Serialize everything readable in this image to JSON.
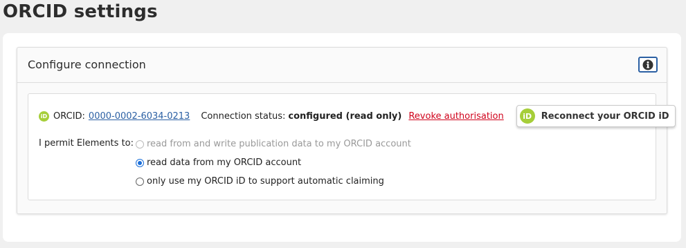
{
  "page": {
    "title": "ORCID settings"
  },
  "panel": {
    "title": "Configure connection",
    "info_icon": "info-circle-icon"
  },
  "connection": {
    "orcid_label": "ORCID:",
    "orcid_id": "0000-0002-6034-0213",
    "status_label": "Connection status:",
    "status_value": "configured (read only)",
    "revoke_label": "Revoke authorisation",
    "reconnect_label": "Reconnect your ORCID iD",
    "orcid_icon_text": "iD",
    "brand_color": "#a6ce39",
    "link_color": "#2a5fa3",
    "revoke_color": "#d0021b"
  },
  "permissions": {
    "label": "I permit Elements to:",
    "options": [
      {
        "label": "read from and write publication data to my ORCID account",
        "checked": false,
        "disabled": true
      },
      {
        "label": "read data from my ORCID account",
        "checked": true,
        "disabled": false
      },
      {
        "label": "only use my ORCID iD to support automatic claiming",
        "checked": false,
        "disabled": false
      }
    ]
  }
}
